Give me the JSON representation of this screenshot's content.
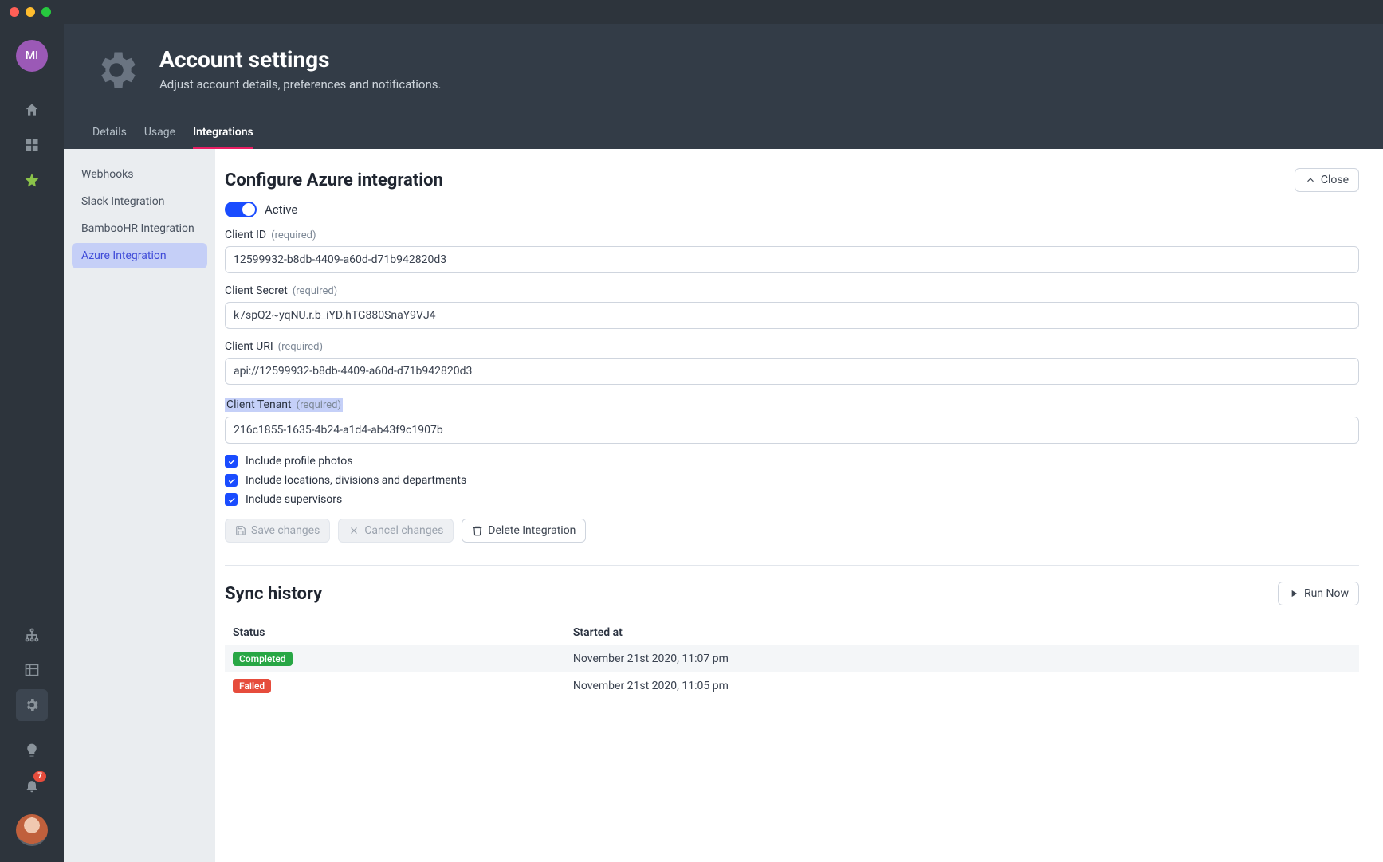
{
  "sidebar": {
    "avatar_initials": "MI",
    "badge_count": "7"
  },
  "header": {
    "title": "Account settings",
    "subtitle": "Adjust account details, preferences and notifications."
  },
  "tabs": {
    "details": "Details",
    "usage": "Usage",
    "integrations": "Integrations"
  },
  "settings_nav": {
    "webhooks": "Webhooks",
    "slack": "Slack Integration",
    "bamboo": "BambooHR Integration",
    "azure": "Azure Integration"
  },
  "panel": {
    "title": "Configure Azure integration",
    "close": "Close",
    "active_label": "Active",
    "fields": {
      "client_id": {
        "label": "Client ID",
        "required": "(required)",
        "value": "12599932-b8db-4409-a60d-d71b942820d3"
      },
      "client_secret": {
        "label": "Client Secret",
        "required": "(required)",
        "value": "k7spQ2~yqNU.r.b_iYD.hTG880SnaY9VJ4"
      },
      "client_uri": {
        "label": "Client URI",
        "required": "(required)",
        "value": "api://12599932-b8db-4409-a60d-d71b942820d3"
      },
      "client_tenant": {
        "label": "Client Tenant",
        "required": "(required)",
        "value": "216c1855-1635-4b24-a1d4-ab43f9c1907b"
      }
    },
    "checks": {
      "photos": "Include profile photos",
      "locations": "Include locations, divisions and departments",
      "supervisors": "Include supervisors"
    },
    "actions": {
      "save": "Save changes",
      "cancel": "Cancel changes",
      "delete": "Delete Integration"
    }
  },
  "sync": {
    "title": "Sync history",
    "run_now": "Run Now",
    "cols": {
      "status": "Status",
      "started": "Started at"
    },
    "rows": [
      {
        "status": "Completed",
        "started": "November 21st 2020, 11:07 pm"
      },
      {
        "status": "Failed",
        "started": "November 21st 2020, 11:05 pm"
      }
    ]
  }
}
